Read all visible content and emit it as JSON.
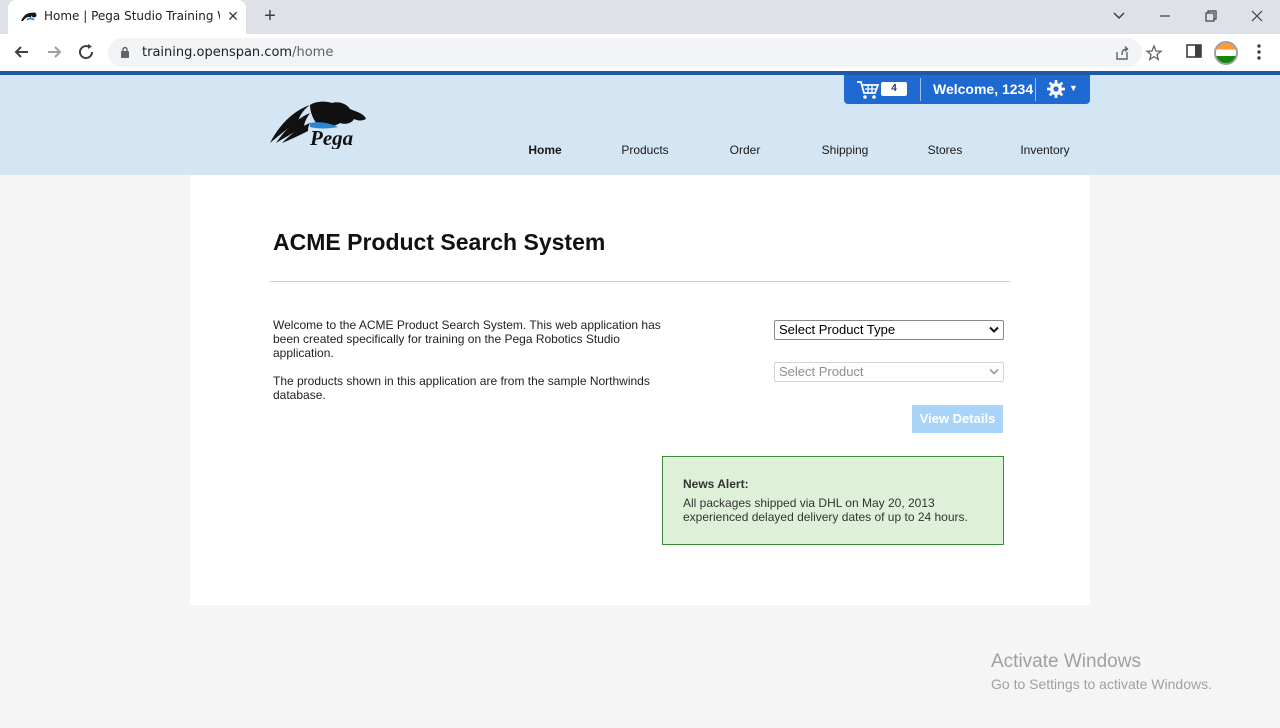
{
  "browser": {
    "tab_title": "Home | Pega Studio Training Web",
    "url_host": "training.openspan.com",
    "url_path": "/home"
  },
  "header": {
    "logo_text": "Pega",
    "cart_count": "4",
    "welcome": "Welcome, 1234",
    "nav": [
      {
        "label": "Home"
      },
      {
        "label": "Products"
      },
      {
        "label": "Order"
      },
      {
        "label": "Shipping"
      },
      {
        "label": "Stores"
      },
      {
        "label": "Inventory"
      }
    ]
  },
  "main": {
    "title": "ACME Product Search System",
    "intro_p1": "Welcome to the ACME Product Search System. This web application has been created specifically for training on the Pega Robotics Studio application.",
    "intro_p2": "The products shown in this application are from the sample Northwinds database.",
    "product_type_select": "Select Product Type",
    "product_select": "Select Product",
    "view_details_label": "View Details",
    "news_alert_title": "News Alert:",
    "news_alert_text": "All packages shipped via DHL on May 20, 2013 experienced delayed delivery dates of up to 24 hours."
  },
  "os_watermark": {
    "title": "Activate Windows",
    "subtitle": "Go to Settings to activate Windows."
  },
  "colors": {
    "header_bg": "#d4e5f3",
    "userbar_bg": "#1e6ad2",
    "alert_bg": "#dff0d8",
    "button_disabled": "#a9d4f9"
  }
}
